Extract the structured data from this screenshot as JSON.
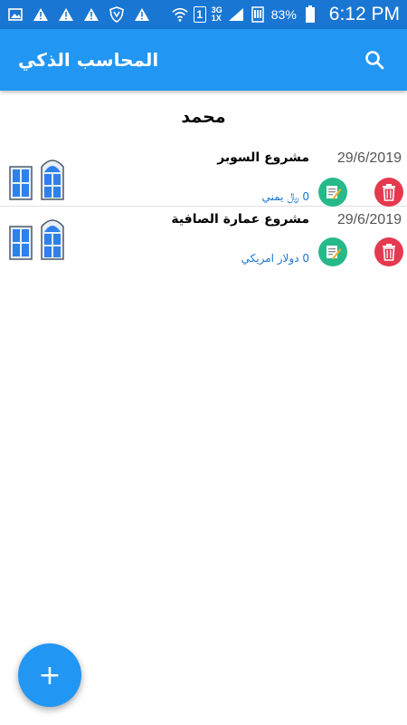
{
  "status_bar": {
    "battery": "83%",
    "time": "6:12 PM",
    "network_top": "3G",
    "network_bottom": "1X",
    "sim": "1",
    "icons": [
      "image-icon",
      "warning-icon",
      "warning-icon",
      "warning-icon",
      "shield-icon",
      "warning-icon",
      "wifi-icon",
      "signal-icon",
      "battery-icon"
    ]
  },
  "app_bar": {
    "title": "المحاسب الذكي",
    "search_icon": "search-icon",
    "color": "#2196f3"
  },
  "section": {
    "title": "محمد"
  },
  "projects": [
    {
      "name": "مشروع السوبر",
      "date": "29/6/2019",
      "amount": "0 ﷼ يمني",
      "edit_icon": "edit-icon",
      "delete_icon": "trash-icon"
    },
    {
      "name": "مشروع عمارة الصافية",
      "date": "29/6/2019",
      "amount": "0 دولار امريكي",
      "edit_icon": "edit-icon",
      "delete_icon": "trash-icon"
    }
  ],
  "fab": {
    "label": "+",
    "color": "#2196f3"
  }
}
